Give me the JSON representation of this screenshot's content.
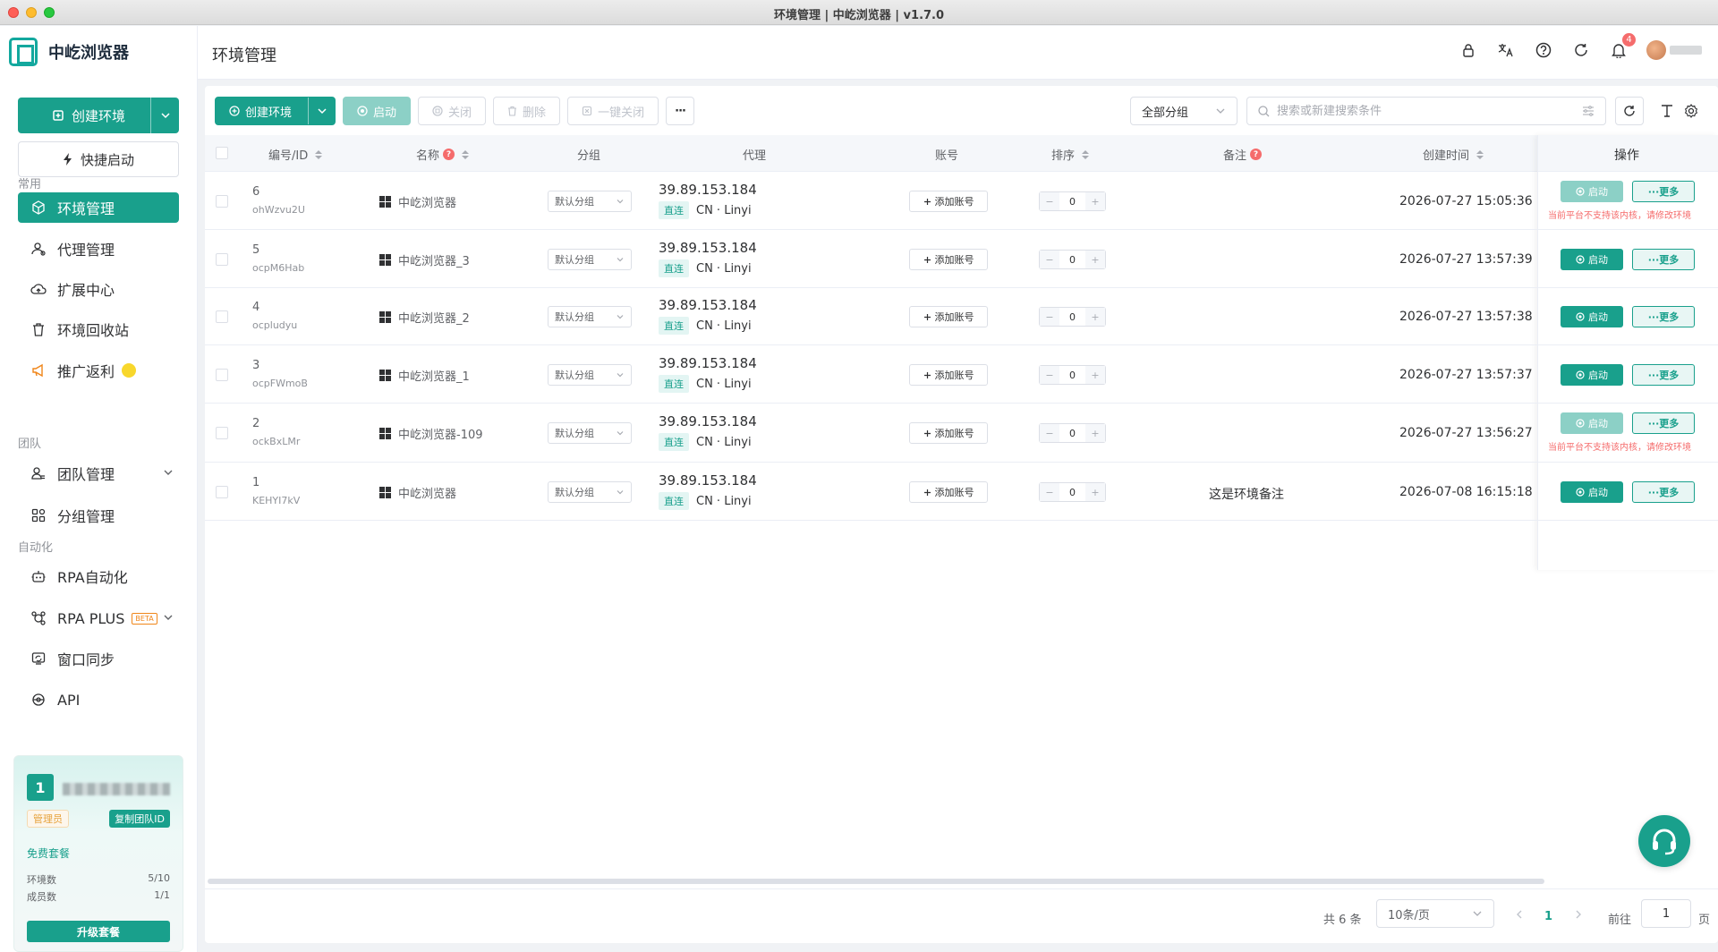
{
  "window": {
    "title": "环境管理 | 中屹浏览器 | v1.7.0"
  },
  "app": {
    "name": "中屹浏览器"
  },
  "sidebar": {
    "create_label": "创建环境",
    "quick_start_label": "快捷启动",
    "section_common": "常用",
    "section_team": "团队",
    "section_auto": "自动化",
    "items": {
      "env": "环境管理",
      "proxy": "代理管理",
      "ext": "扩展中心",
      "recycle": "环境回收站",
      "promo": "推广返利",
      "team": "团队管理",
      "group": "分组管理",
      "rpa": "RPA自动化",
      "rpaplus": "RPA PLUS",
      "rpaplus_badge": "BETA",
      "sync": "窗口同步",
      "api": "API"
    },
    "team_card": {
      "number": "1",
      "role": "管理员",
      "copy_label": "复制团队ID",
      "plan": "免费套餐",
      "env_count_label": "环境数",
      "env_count": "5/10",
      "member_count_label": "成员数",
      "member_count": "1/1",
      "upgrade_label": "升级套餐"
    }
  },
  "header": {
    "title": "环境管理",
    "notification_count": "4"
  },
  "toolbar": {
    "create": "创建环境",
    "start": "启动",
    "close": "关闭",
    "delete": "删除",
    "close_all": "一键关闭",
    "more": "···",
    "group_filter": "全部分组",
    "search_placeholder": "搜索或新建搜索条件"
  },
  "table": {
    "headers": {
      "id": "编号/ID",
      "name": "名称",
      "group": "分组",
      "proxy": "代理",
      "account": "账号",
      "order": "排序",
      "note": "备注",
      "created": "创建时间",
      "ops": "操作"
    },
    "add_account_label": "添加账号",
    "start_label": "启动",
    "more_label": "···更多",
    "direct_label": "直连",
    "rows": [
      {
        "num": "6",
        "code": "ohWzvu2U",
        "name": "中屹浏览器",
        "group": "默认分组",
        "ip": "39.89.153.184",
        "loc": "CN · Linyi",
        "order": "0",
        "note": "",
        "created": "2026-07-27 15:05:36",
        "start_disabled": true,
        "warn": "当前平台不支持该内核，请修改环境"
      },
      {
        "num": "5",
        "code": "ocpM6Hab",
        "name": "中屹浏览器_3",
        "group": "默认分组",
        "ip": "39.89.153.184",
        "loc": "CN · Linyi",
        "order": "0",
        "note": "",
        "created": "2026-07-27 13:57:39",
        "start_disabled": false,
        "warn": ""
      },
      {
        "num": "4",
        "code": "ocpludyu",
        "name": "中屹浏览器_2",
        "group": "默认分组",
        "ip": "39.89.153.184",
        "loc": "CN · Linyi",
        "order": "0",
        "note": "",
        "created": "2026-07-27 13:57:38",
        "start_disabled": false,
        "warn": ""
      },
      {
        "num": "3",
        "code": "ocpFWmoB",
        "name": "中屹浏览器_1",
        "group": "默认分组",
        "ip": "39.89.153.184",
        "loc": "CN · Linyi",
        "order": "0",
        "note": "",
        "created": "2026-07-27 13:57:37",
        "start_disabled": false,
        "warn": ""
      },
      {
        "num": "2",
        "code": "ockBxLMr",
        "name": "中屹浏览器-109",
        "group": "默认分组",
        "ip": "39.89.153.184",
        "loc": "CN · Linyi",
        "order": "0",
        "note": "",
        "created": "2026-07-27 13:56:27",
        "start_disabled": true,
        "warn": "当前平台不支持该内核，请修改环境"
      },
      {
        "num": "1",
        "code": "KEHYI7kV",
        "name": "中屹浏览器",
        "group": "默认分组",
        "ip": "39.89.153.184",
        "loc": "CN · Linyi",
        "order": "0",
        "note": "这是环境备注",
        "created": "2026-07-08 16:15:18",
        "start_disabled": false,
        "warn": ""
      }
    ]
  },
  "pagination": {
    "total": "共 6 条",
    "page_size": "10条/页",
    "current": "1",
    "goto_label": "前往",
    "goto_value": "1",
    "page_suffix": "页"
  },
  "colors": {
    "primary": "#19a08c",
    "primary_disabled": "#8cd0c6",
    "danger": "#f56c6c"
  }
}
